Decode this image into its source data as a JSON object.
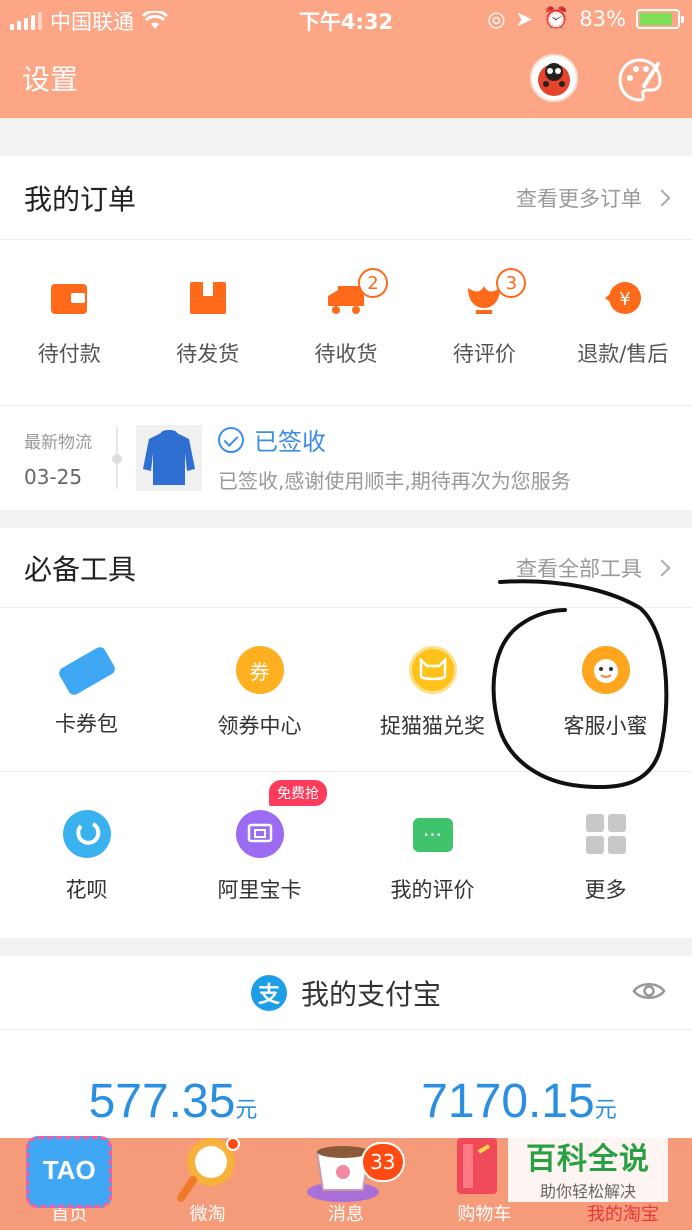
{
  "status_bar": {
    "carrier": "中国联通",
    "time": "下午4:32",
    "battery": "83%"
  },
  "header": {
    "settings_label": "设置"
  },
  "orders": {
    "title": "我的订单",
    "more": "查看更多订单",
    "items": [
      {
        "label": "待付款",
        "icon": "wallet-icon",
        "badge": ""
      },
      {
        "label": "待发货",
        "icon": "box-icon",
        "badge": ""
      },
      {
        "label": "待收货",
        "icon": "truck-icon",
        "badge": "2"
      },
      {
        "label": "待评价",
        "icon": "flower-icon",
        "badge": "3"
      },
      {
        "label": "退款/售后",
        "icon": "refund-icon",
        "badge": ""
      }
    ]
  },
  "logistics": {
    "title": "最新物流",
    "date": "03-25",
    "status": "已签收",
    "desc": "已签收,感谢使用顺丰,期待再次为您服务"
  },
  "tools": {
    "title": "必备工具",
    "more": "查看全部工具",
    "items": [
      {
        "label": "卡券包",
        "icon": "ticket-icon",
        "color": "#3ea8f5"
      },
      {
        "label": "领券中心",
        "icon": "coupon-icon",
        "glyph": "券",
        "color": "#ffb020"
      },
      {
        "label": "捉猫猫兑奖",
        "icon": "cat-face-icon",
        "color": "#ffc21a"
      },
      {
        "label": "客服小蜜",
        "icon": "service-bee-icon",
        "color": "#ffa51e"
      },
      {
        "label": "花呗",
        "icon": "huabei-icon",
        "color": "#3ab2f0"
      },
      {
        "label": "阿里宝卡",
        "icon": "sim-card-icon",
        "color": "#9b6cf2",
        "promo": "免费抢"
      },
      {
        "label": "我的评价",
        "icon": "chat-bubble-icon",
        "color": "#3fc36b"
      },
      {
        "label": "更多",
        "icon": "grid-icon",
        "color": "#c8c8c8"
      }
    ]
  },
  "alipay": {
    "glyph": "支",
    "title": "我的支付宝",
    "balances": [
      {
        "value": "577.35",
        "unit": "元"
      },
      {
        "value": "7170.15",
        "unit": "元"
      }
    ]
  },
  "tabbar": {
    "items": [
      {
        "label": "首页",
        "art": "TAO",
        "color": "#3fa7f3"
      },
      {
        "label": "微淘",
        "color": "#f6b23b"
      },
      {
        "label": "消息",
        "badge": "33",
        "color": "#a86fd8"
      },
      {
        "label": "购物车",
        "color": "#f04a5a"
      },
      {
        "label": "我的淘宝",
        "active": true,
        "color": "#f59b7a"
      }
    ]
  },
  "watermark": {
    "big": "百科全说",
    "small": "助你轻松解决"
  }
}
